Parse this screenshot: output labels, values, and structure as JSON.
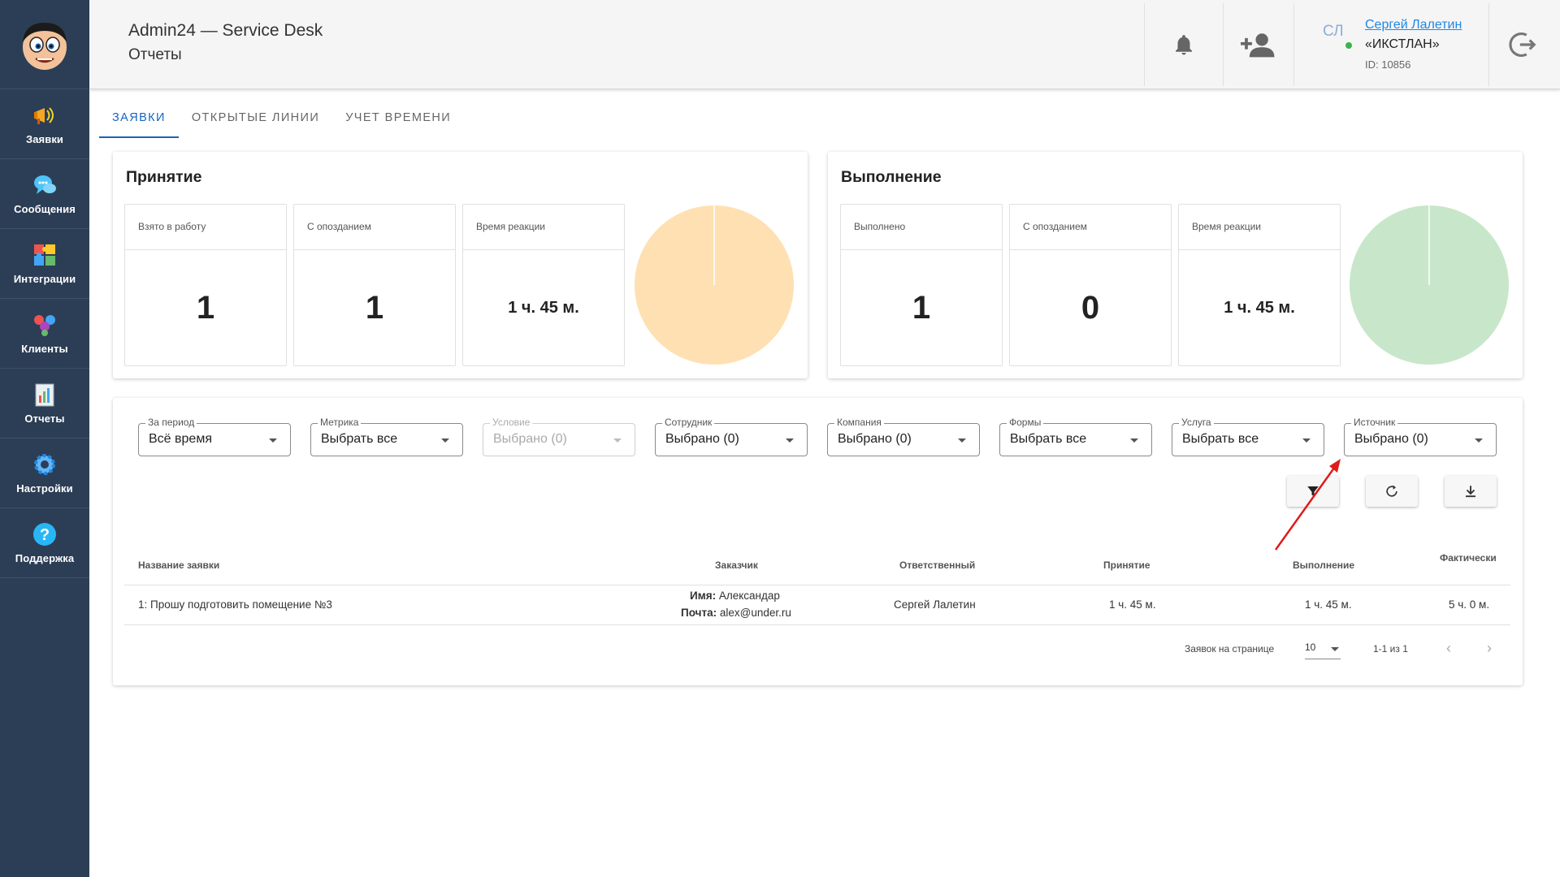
{
  "app": {
    "title": "Admin24 — Service Desk",
    "page": "Отчеты"
  },
  "user": {
    "initials": "СЛ",
    "name": "Сергей Лалетин",
    "company": "«ИКСТЛАН»",
    "id": "ID: 10856"
  },
  "sidebar": {
    "items": [
      {
        "label": "Заявки",
        "icon": "megaphone-icon"
      },
      {
        "label": "Сообщения",
        "icon": "chat-bubbles-icon"
      },
      {
        "label": "Интеграции",
        "icon": "puzzle-icon"
      },
      {
        "label": "Клиенты",
        "icon": "people-icon"
      },
      {
        "label": "Отчеты",
        "icon": "report-chart-icon"
      },
      {
        "label": "Настройки",
        "icon": "gear-icon"
      },
      {
        "label": "Поддержка",
        "icon": "question-icon"
      }
    ]
  },
  "tabs": [
    {
      "label": "Заявки",
      "active": true
    },
    {
      "label": "Открытые линии",
      "active": false
    },
    {
      "label": "Учет времени",
      "active": false
    }
  ],
  "acceptance": {
    "title": "Принятие",
    "stats": [
      {
        "label": "Взято в работу",
        "value": "1"
      },
      {
        "label": "С опозданием",
        "value": "1"
      },
      {
        "label": "Время реакции",
        "value": "1 ч. 45 м."
      }
    ],
    "pie_color": "#ffe0b2"
  },
  "completion": {
    "title": "Выполнение",
    "stats": [
      {
        "label": "Выполнено",
        "value": "1"
      },
      {
        "label": "С опозданием",
        "value": "0"
      },
      {
        "label": "Время реакции",
        "value": "1 ч. 45 м."
      }
    ],
    "pie_color": "#c8e6c9"
  },
  "filters": [
    {
      "label": "За период",
      "value": "Всё время",
      "disabled": false
    },
    {
      "label": "Метрика",
      "value": "Выбрать все",
      "disabled": false
    },
    {
      "label": "Условие",
      "value": "Выбрано (0)",
      "disabled": true
    },
    {
      "label": "Сотрудник",
      "value": "Выбрано (0)",
      "disabled": false
    },
    {
      "label": "Компания",
      "value": "Выбрано (0)",
      "disabled": false
    },
    {
      "label": "Формы",
      "value": "Выбрать все",
      "disabled": false
    },
    {
      "label": "Услуга",
      "value": "Выбрать все",
      "disabled": false
    },
    {
      "label": "Источник",
      "value": "Выбрано (0)",
      "disabled": false
    }
  ],
  "actions": [
    {
      "icon": "filter-icon"
    },
    {
      "icon": "refresh-icon"
    },
    {
      "icon": "download-icon"
    }
  ],
  "table": {
    "headers": {
      "name": "Название заявки",
      "customer": "Заказчик",
      "responsible": "Ответственный",
      "accept": "Принятие",
      "complete": "Выполнение",
      "actual": "Фактически"
    },
    "rows": [
      {
        "name": "1: Прошу подготовить помещение №3",
        "customer_name_label": "Имя:",
        "customer_name": "Александар",
        "customer_email_label": "Почта:",
        "customer_email": "alex@under.ru",
        "responsible": "Сергей Лалетин",
        "accept": "1 ч. 45 м.",
        "complete": "1 ч. 45 м.",
        "actual": "5 ч. 0 м."
      }
    ]
  },
  "pagination": {
    "per_page_label": "Заявок на странице",
    "per_page": "10",
    "range": "1-1 из 1"
  },
  "colors": {
    "sidebar": "#2c3e56",
    "accent": "#1565c0",
    "annotation_arrow": "#e01b1b"
  }
}
